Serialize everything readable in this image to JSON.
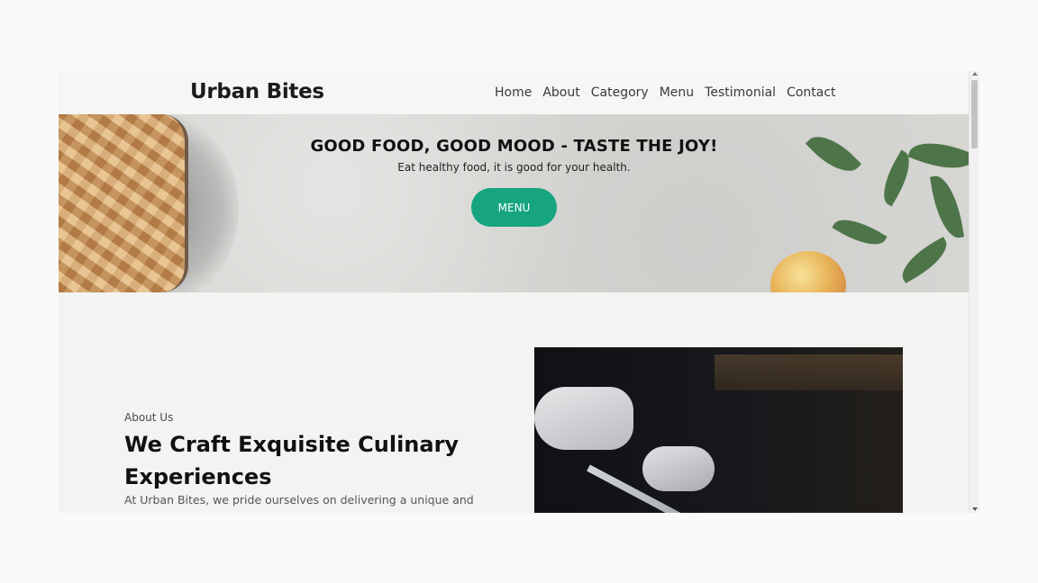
{
  "header": {
    "brand": "Urban Bites",
    "nav": [
      "Home",
      "About",
      "Category",
      "Menu",
      "Testimonial",
      "Contact"
    ]
  },
  "hero": {
    "title": "GOOD FOOD, GOOD MOOD - TASTE THE JOY!",
    "subtitle": "Eat healthy food, it is good for your health.",
    "button_label": "MENU"
  },
  "about": {
    "label": "About Us",
    "title": "We Craft Exquisite Culinary Experiences",
    "text": "At Urban Bites, we pride ourselves on delivering a unique and"
  },
  "colors": {
    "accent": "#17a57f"
  }
}
